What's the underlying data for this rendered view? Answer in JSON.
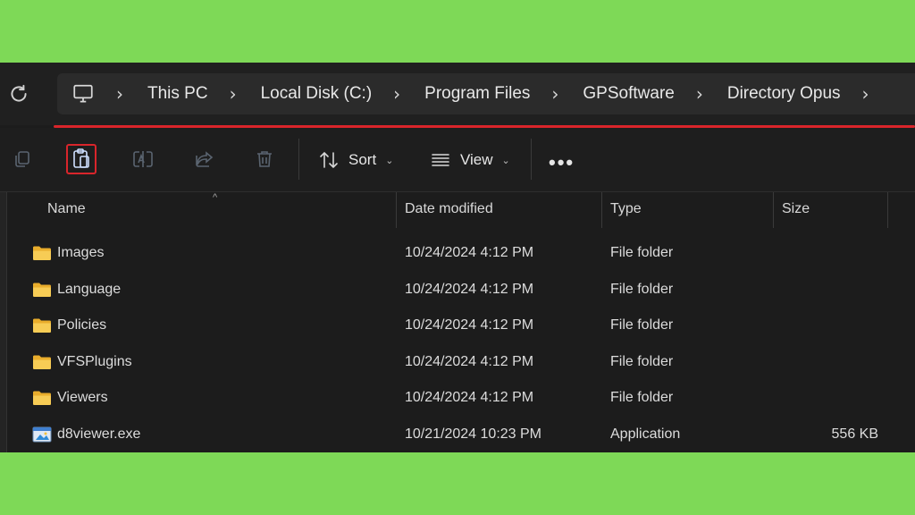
{
  "colors": {
    "background": "#7ed957",
    "highlight": "#d9252b",
    "folder": "#f4c542"
  },
  "address": {
    "icons": [
      "refresh-icon",
      "pc-icon"
    ],
    "crumbs": [
      "This PC",
      "Local Disk (C:)",
      "Program Files",
      "GPSoftware",
      "Directory Opus"
    ]
  },
  "toolbar": {
    "icons": [
      "copy-icon",
      "paste-icon",
      "rename-icon",
      "share-icon",
      "delete-icon"
    ],
    "highlighted": "paste-icon",
    "sort_label": "Sort",
    "view_label": "View",
    "more_label": "•••"
  },
  "columns": {
    "name": "Name",
    "date": "Date modified",
    "type": "Type",
    "size": "Size"
  },
  "files": [
    {
      "name": "Images",
      "date": "10/24/2024 4:12 PM",
      "type": "File folder",
      "size": "",
      "icon": "folder-icon"
    },
    {
      "name": "Language",
      "date": "10/24/2024 4:12 PM",
      "type": "File folder",
      "size": "",
      "icon": "folder-icon"
    },
    {
      "name": "Policies",
      "date": "10/24/2024 4:12 PM",
      "type": "File folder",
      "size": "",
      "icon": "folder-icon"
    },
    {
      "name": "VFSPlugins",
      "date": "10/24/2024 4:12 PM",
      "type": "File folder",
      "size": "",
      "icon": "folder-icon"
    },
    {
      "name": "Viewers",
      "date": "10/24/2024 4:12 PM",
      "type": "File folder",
      "size": "",
      "icon": "folder-icon"
    },
    {
      "name": "d8viewer.exe",
      "date": "10/21/2024 10:23 PM",
      "type": "Application",
      "size": "556 KB",
      "icon": "application-icon"
    }
  ]
}
